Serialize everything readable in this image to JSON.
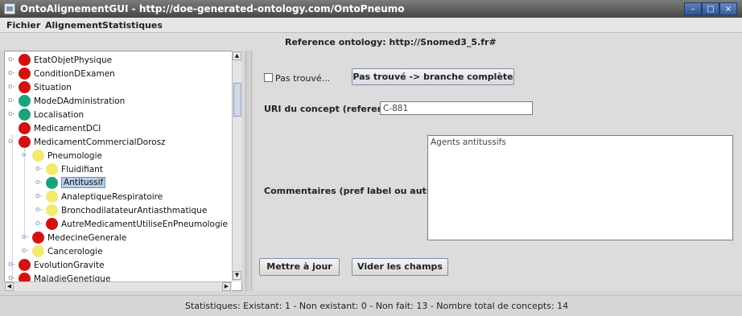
{
  "window": {
    "title": "OntoAlignementGUI - http://doe-generated-ontology.com/OntoPneumo"
  },
  "window_controls": {
    "minimize": "–",
    "maximize": "□",
    "close": "×"
  },
  "menu": [
    "Fichier",
    "Alignement",
    "Statistiques"
  ],
  "reference": "Reference ontology: http://Snomed3_5.fr#",
  "tree": [
    {
      "label": "EtatObjetPhysique",
      "color": "#d41111",
      "depth": 0,
      "handle": "o-"
    },
    {
      "label": "ConditionDExamen",
      "color": "#d41111",
      "depth": 0,
      "handle": "o-"
    },
    {
      "label": "Situation",
      "color": "#d41111",
      "depth": 0,
      "handle": "o-"
    },
    {
      "label": "ModeDAdministration",
      "color": "#1aa37a",
      "depth": 0,
      "handle": "o-"
    },
    {
      "label": "Localisation",
      "color": "#1aa37a",
      "depth": 0,
      "handle": "o-"
    },
    {
      "label": "MedicamentDCI",
      "color": "#d41111",
      "depth": 0,
      "handle": ""
    },
    {
      "label": "MedicamentCommercialDorosz",
      "color": "#d41111",
      "depth": 0,
      "handle": "o"
    },
    {
      "label": "Pneumologie",
      "color": "#f4ea6e",
      "depth": 1,
      "handle": "o"
    },
    {
      "label": "Fluidifiant",
      "color": "#f4ea6e",
      "depth": 2,
      "handle": "o-"
    },
    {
      "label": "Antitussif",
      "color": "#1aa37a",
      "depth": 2,
      "handle": "o-",
      "selected": true
    },
    {
      "label": "AnaleptiqueRespiratoire",
      "color": "#f4ea6e",
      "depth": 2,
      "handle": "o-"
    },
    {
      "label": "BronchodilatateurAntiasthmatique",
      "color": "#f4ea6e",
      "depth": 2,
      "handle": "o-"
    },
    {
      "label": "AutreMedicamentUtiliseEnPneumologie",
      "color": "#d41111",
      "depth": 2,
      "handle": "o-"
    },
    {
      "label": "MedecineGenerale",
      "color": "#d41111",
      "depth": 1,
      "handle": "o-"
    },
    {
      "label": "Cancerologie",
      "color": "#f4ea6e",
      "depth": 1,
      "handle": "o-"
    },
    {
      "label": "EvolutionGravite",
      "color": "#d41111",
      "depth": 0,
      "handle": "o-"
    },
    {
      "label": "MaladieGenetique",
      "color": "#d41111",
      "depth": 0,
      "handle": "o-"
    }
  ],
  "form": {
    "pas_trouve_label": "Pas trouvé...",
    "pas_trouve_branche_button": "Pas trouvé -> branche complète",
    "uri_label": "URI du concept (reference):",
    "uri_value": "C-881",
    "commentaires_label": "Commentaires (pref label ou autres):",
    "commentaires_value": "Agents antitussifs",
    "mettre_a_jour_button": "Mettre à jour",
    "vider_button": "Vider les champs"
  },
  "status": "Statistiques: Existant: 1 - Non existant: 0 - Non fait: 13 - Nombre total de concepts: 14"
}
